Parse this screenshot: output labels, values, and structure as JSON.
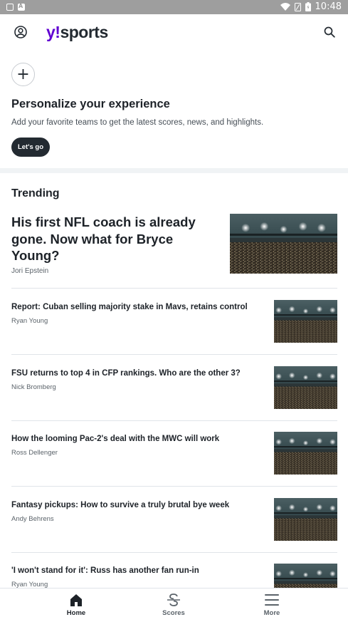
{
  "status_bar": {
    "time": "10:48"
  },
  "header": {
    "logo_y": "y!",
    "logo_text": "sports"
  },
  "personalize": {
    "add_symbol": "+",
    "title": "Personalize your experience",
    "description": "Add your favorite teams to get the latest scores, news, and highlights.",
    "cta_label": "Let's go"
  },
  "trending": {
    "title": "Trending",
    "hero": {
      "headline": "His first NFL coach is already gone. Now what for Bryce Young?",
      "author": "Jori Epstein"
    },
    "stories": [
      {
        "headline": "Report: Cuban selling majority stake in Mavs, retains control",
        "author": "Ryan Young"
      },
      {
        "headline": "FSU returns to top 4 in CFP rankings. Who are the other 3?",
        "author": "Nick Bromberg"
      },
      {
        "headline": "How the looming Pac-2's deal with the MWC will work",
        "author": "Ross Dellenger"
      },
      {
        "headline": "Fantasy pickups: How to survive a truly brutal bye week",
        "author": "Andy Behrens"
      },
      {
        "headline": "'I won't stand for it': Russ has another fan run-in",
        "author": "Ryan Young"
      }
    ]
  },
  "bottom_nav": {
    "items": [
      {
        "label": "Home",
        "icon": "home-icon",
        "active": true
      },
      {
        "label": "Scores",
        "icon": "scores-icon",
        "active": false
      },
      {
        "label": "More",
        "icon": "menu-icon",
        "active": false
      }
    ]
  },
  "colors": {
    "brand_purple": "#6001d2",
    "text_primary": "#1d2228",
    "text_secondary": "#5b636a",
    "button_dark": "#232a31",
    "status_bar": "#9e9e9e"
  }
}
